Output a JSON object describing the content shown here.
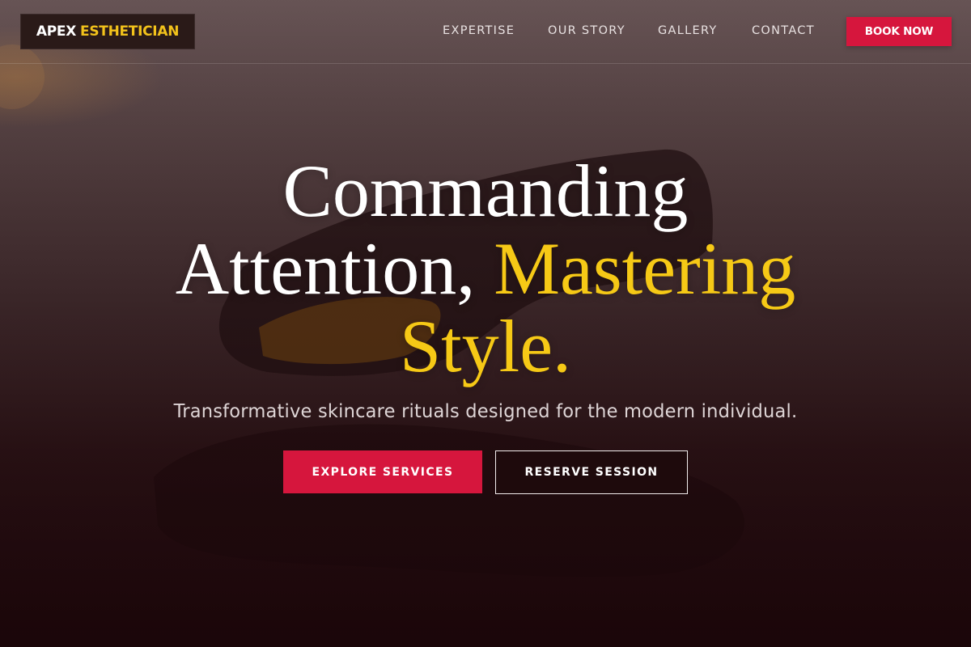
{
  "header": {
    "logo": {
      "part1": "APEX",
      "part2": "ESTHETICIAN"
    },
    "nav": [
      {
        "label": "EXPERTISE"
      },
      {
        "label": "OUR STORY"
      },
      {
        "label": "GALLERY"
      },
      {
        "label": "CONTACT"
      }
    ],
    "book_button": "BOOK NOW"
  },
  "hero": {
    "headline": {
      "line1": "Commanding",
      "line2_white": "Attention,",
      "line2_gold": "Mastering",
      "line3_gold": "Style."
    },
    "subtitle": "Transformative skincare rituals designed for the modern individual.",
    "primary_button": "EXPLORE SERVICES",
    "secondary_button": "RESERVE SESSION"
  },
  "colors": {
    "accent_red": "#d6163d",
    "accent_gold": "#f6c916",
    "background_dark": "#1e0a0d"
  },
  "icons": {
    "background": "sunglasses-photo"
  }
}
